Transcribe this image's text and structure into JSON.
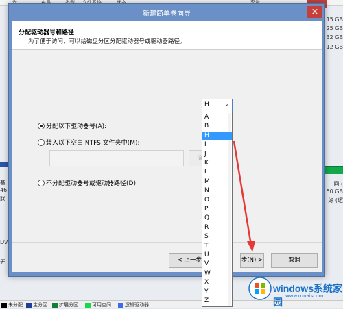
{
  "background_window": {
    "header_cols": [
      "卷",
      "布局",
      "类型",
      "文件系统",
      "状态",
      "容量"
    ],
    "right_sizes": [
      "15 GB",
      "25 GB",
      "32 GB",
      "12 GB"
    ],
    "right_labels": [
      "问 (",
      "50 GB",
      "好 (逻"
    ],
    "left_labels": [
      "基",
      "46",
      "联",
      "DV",
      "无"
    ],
    "legend": [
      {
        "label": "未分配",
        "color": "#000000"
      },
      {
        "label": "主分区",
        "color": "#1f3f94"
      },
      {
        "label": "扩展分区",
        "color": "#0f7f3a"
      },
      {
        "label": "可用空间",
        "color": "#19d84d"
      },
      {
        "label": "逻辑驱动器",
        "color": "#3a6ee8"
      }
    ]
  },
  "dialog": {
    "title": "新建简单卷向导",
    "close_symbol": "×",
    "header": {
      "title": "分配驱动器号和路径",
      "description": "为了便于访问，可以给磁盘分区分配驱动器号或驱动器路径。"
    },
    "options": [
      {
        "label": "分配以下驱动器号(A):",
        "checked": true
      },
      {
        "label": "装入以下空白 NTFS 文件夹中(M):",
        "checked": false
      },
      {
        "label": "不分配驱动器号或驱动器路径(D)",
        "checked": false
      }
    ],
    "browse_label": "浏",
    "drive_combo": {
      "value": "H",
      "options": [
        "A",
        "B",
        "H",
        "I",
        "J",
        "K",
        "L",
        "M",
        "N",
        "O",
        "P",
        "Q",
        "R",
        "S",
        "T",
        "U",
        "V",
        "W",
        "X",
        "Y",
        "Z"
      ],
      "selected": "H"
    },
    "buttons": {
      "back": "< 上一步(",
      "next": "步(N) >",
      "cancel": "取消"
    }
  },
  "watermark": {
    "text": "windows系统家园",
    "url": "www.runaiscom"
  },
  "colors": {
    "title_bar": "#6b8fc7",
    "selection": "#3399ff",
    "annotation_arrow": "#e53935"
  }
}
